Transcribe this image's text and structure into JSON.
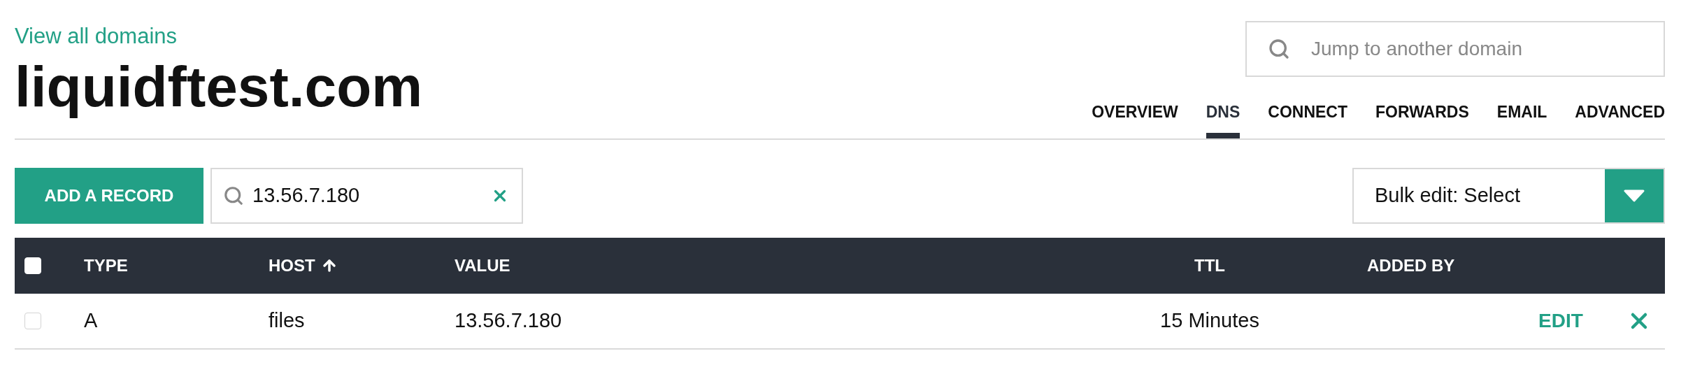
{
  "back_link": "View all domains",
  "domain_title": "liquidftest.com",
  "domain_search": {
    "placeholder": "Jump to another domain"
  },
  "tabs": [
    {
      "label": "OVERVIEW",
      "selected": false
    },
    {
      "label": "DNS",
      "selected": true
    },
    {
      "label": "CONNECT",
      "selected": false
    },
    {
      "label": "FORWARDS",
      "selected": false
    },
    {
      "label": "EMAIL",
      "selected": false
    },
    {
      "label": "ADVANCED",
      "selected": false
    }
  ],
  "toolbar": {
    "add_button": "ADD A RECORD",
    "filter": {
      "value": "13.56.7.180"
    },
    "bulk_edit": {
      "value": "Bulk edit: Select"
    }
  },
  "table": {
    "select_all": {
      "checked": false
    },
    "columns": [
      {
        "label": "TYPE",
        "sorted": false
      },
      {
        "label": "HOST",
        "sorted": true
      },
      {
        "label": "VALUE",
        "sorted": false
      },
      {
        "label": "TTL",
        "sorted": false
      },
      {
        "label": "ADDED BY",
        "sorted": false
      }
    ],
    "rows": [
      {
        "checked": false,
        "type": "A",
        "host": "files",
        "value": "13.56.7.180",
        "ttl": "15 Minutes",
        "added_by": "",
        "edit": "EDIT"
      }
    ]
  }
}
